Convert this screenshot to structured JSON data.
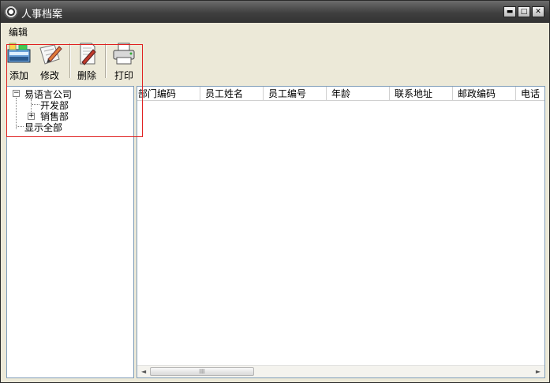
{
  "window": {
    "title": "人事档案",
    "controls": [
      "▬",
      "□",
      "✕"
    ]
  },
  "menu": {
    "edit": "编辑"
  },
  "toolbar": {
    "add": "添加",
    "modify": "修改",
    "delete": "删除",
    "print": "打印"
  },
  "tree": {
    "root": "易语言公司",
    "children": [
      "开发部",
      "销售部"
    ],
    "show_all": "显示全部",
    "root_expander": "⊟",
    "child_expander": "⊞"
  },
  "table": {
    "columns": [
      "部门编码",
      "员工姓名",
      "员工编号",
      "年龄",
      "联系地址",
      "邮政编码",
      "电话"
    ]
  },
  "scroll": {
    "left": "◄",
    "right": "►",
    "grip": "III"
  },
  "colors": {
    "highlight": "#e02020",
    "pane_border": "#7f9db9",
    "titlebar": "#3f3f3f"
  }
}
